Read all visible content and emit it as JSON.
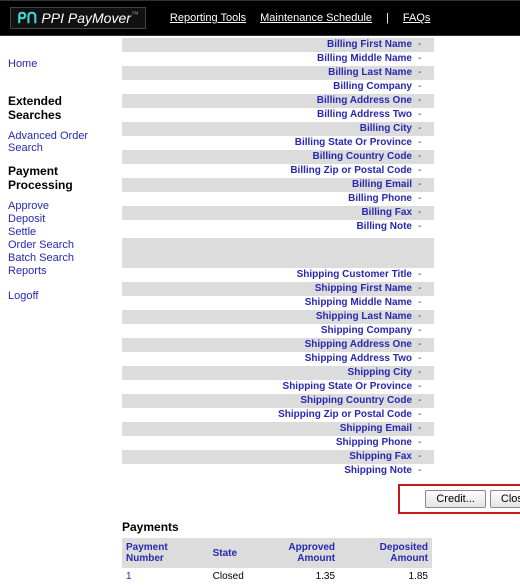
{
  "header": {
    "brand_prefix": "PPI",
    "brand_main": "PayMover",
    "nav": [
      "Reporting Tools",
      "Maintenance Schedule",
      "FAQs"
    ]
  },
  "sidebar": {
    "home": "Home",
    "extended_title": "Extended Searches",
    "extended_links": [
      "Advanced Order Search"
    ],
    "processing_title": "Payment Processing",
    "processing_links": [
      "Approve",
      "Deposit",
      "Settle",
      "Order Search",
      "Batch Search",
      "Reports"
    ],
    "logoff": "Logoff"
  },
  "billing_fields": [
    "Billing First Name",
    "Billing Middle Name",
    "Billing Last Name",
    "Billing Company",
    "Billing Address One",
    "Billing Address Two",
    "Billing City",
    "Billing State Or Province",
    "Billing Country Code",
    "Billing Zip or Postal Code",
    "Billing Email",
    "Billing Phone",
    "Billing Fax",
    "Billing Note"
  ],
  "billing_values": [
    "-",
    "-",
    "-",
    "-",
    "-",
    "-",
    "-",
    "-",
    "-",
    "-",
    "-",
    "-",
    "-",
    "-"
  ],
  "shipping_fields": [
    "Shipping Customer Title",
    "Shipping First Name",
    "Shipping Middle Name",
    "Shipping Last Name",
    "Shipping Company",
    "Shipping Address One",
    "Shipping Address Two",
    "Shipping City",
    "Shipping State Or Province",
    "Shipping Country Code",
    "Shipping Zip or Postal Code",
    "Shipping Email",
    "Shipping Phone",
    "Shipping Fax",
    "Shipping Note"
  ],
  "shipping_values": [
    "-",
    "-",
    "-",
    "-",
    "-",
    "-",
    "-",
    "-",
    "-",
    "-",
    "-",
    "-",
    "-",
    "-",
    "-"
  ],
  "buttons": {
    "credit": "Credit...",
    "close": "Close"
  },
  "payments": {
    "title": "Payments",
    "headers": [
      "Payment Number",
      "State",
      "Approved Amount",
      "Deposited Amount"
    ],
    "rows": [
      {
        "number": "1",
        "state": "Closed",
        "approved": "1.35",
        "deposited": "1.85"
      }
    ]
  }
}
